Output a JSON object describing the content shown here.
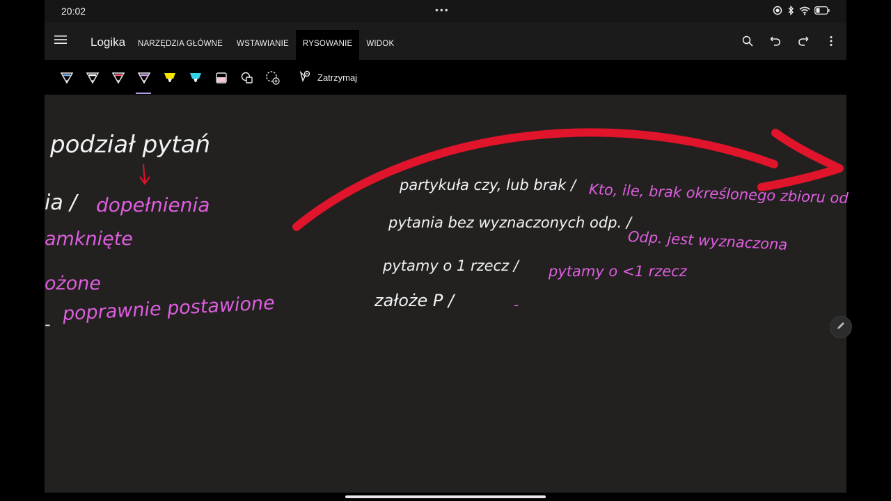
{
  "status": {
    "time": "20:02",
    "dots": "•••"
  },
  "appbar": {
    "title": "Logika",
    "tabs": [
      {
        "label": "NARZĘDZIA GŁÓWNE"
      },
      {
        "label": "WSTAWIANIE"
      },
      {
        "label": "RYSOWANIE",
        "active": true
      },
      {
        "label": "WIDOK"
      }
    ]
  },
  "drawbar": {
    "stop_label": "Zatrzymaj",
    "pen_colors": [
      "#7fb3ff",
      "#ffffff",
      "#ff5a7a",
      "#d6a0ff"
    ],
    "highlighter_colors": [
      "#f5e400",
      "#35d3e8",
      "#f2c7d8"
    ]
  },
  "canvas": {
    "left": {
      "heading": "podział pytań",
      "row1_white": "ia /",
      "row1_pink": "dopełnienia",
      "row2": "amknięte",
      "row3": "ożone",
      "row4_white": "-",
      "row4_pink": "poprawnie postawione"
    },
    "right": {
      "row1_white": "partykuła czy, lub brak /",
      "row1_pink": "Kto, ile, brak określonego zbioru od",
      "row2_white": "pytania bez wyznaczonych odp. /",
      "row2_pink": "Odp. jest wyznaczona",
      "row3_white": "pytamy o 1 rzecz /",
      "row3_pink": "pytamy o <1 rzecz",
      "row4_white": "założe P /",
      "row4_pink": "-"
    },
    "arrow_color": "#e0142a"
  }
}
